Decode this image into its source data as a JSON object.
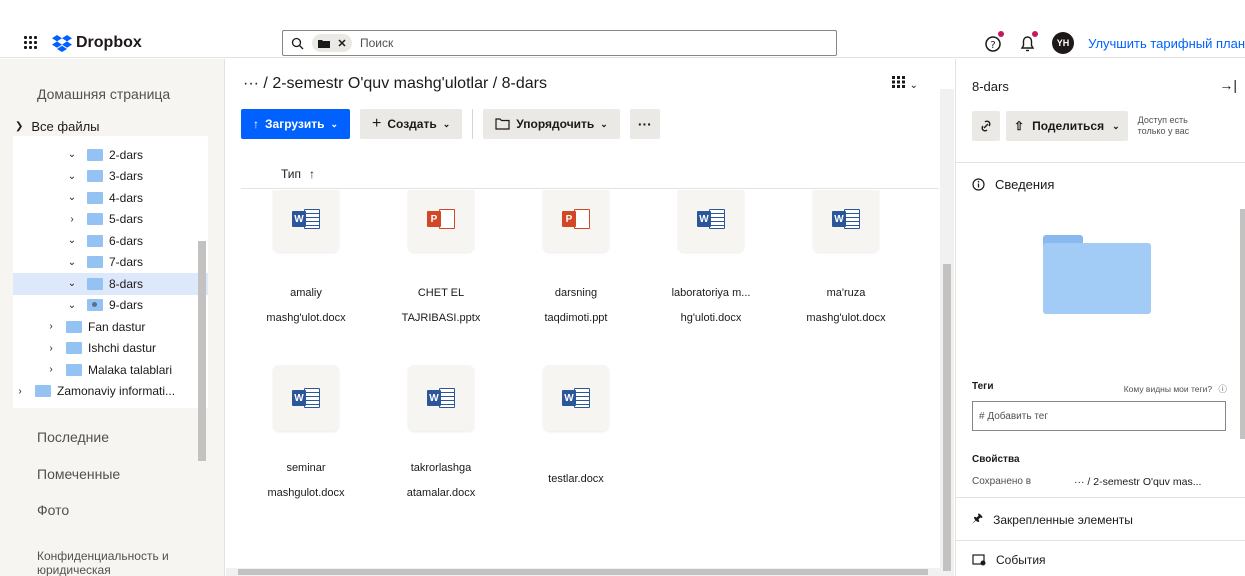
{
  "topbar": {
    "logo_text": "Dropbox",
    "search_chip_label": "",
    "search_placeholder": "Поиск",
    "avatar_initials": "YH",
    "upgrade_link": "Улучшить тарифный план",
    "brand_color": "#0061fe"
  },
  "sidebar": {
    "home": "Домашняя страница",
    "all_files": "Все файлы",
    "tree": [
      {
        "label": "2-dars",
        "chevron": "down",
        "selected": false
      },
      {
        "label": "3-dars",
        "chevron": "down",
        "selected": false
      },
      {
        "label": "4-dars",
        "chevron": "down",
        "selected": false
      },
      {
        "label": "5-dars",
        "chevron": "right",
        "selected": false
      },
      {
        "label": "6-dars",
        "chevron": "down",
        "selected": false
      },
      {
        "label": "7-dars",
        "chevron": "down",
        "selected": false
      },
      {
        "label": "8-dars",
        "chevron": "down",
        "selected": true
      },
      {
        "label": "9-dars",
        "chevron": "down",
        "selected": false
      },
      {
        "label": "Fan dastur",
        "chevron": "right",
        "selected": false
      },
      {
        "label": "Ishchi dastur",
        "chevron": "right",
        "selected": false
      },
      {
        "label": "Malaka talablari",
        "chevron": "right",
        "selected": false
      },
      {
        "label": "Zamonaviy informati...",
        "chevron": "right",
        "selected": false
      }
    ],
    "recent": "Последние",
    "starred": "Помеченные",
    "photos": "Фото",
    "privacy": "Конфиденциальность и юридическая"
  },
  "main": {
    "breadcrumb": "··· / 2-semestr O'quv mashg'ulotlar / 8-dars",
    "upload_label": "Загрузить",
    "create_label": "Создать",
    "organize_label": "Упорядочить",
    "more_label": "···",
    "sort_label": "Тип",
    "files": [
      {
        "line1": "amaliy",
        "line2": "mashg'ulot.docx",
        "type": "word"
      },
      {
        "line1": "CHET EL",
        "line2": "TAJRIBASI.pptx",
        "type": "ppt"
      },
      {
        "line1": "darsning",
        "line2": "taqdimoti.ppt",
        "type": "ppt"
      },
      {
        "line1": "laboratoriya m...",
        "line2": "hg'uloti.docx",
        "type": "word"
      },
      {
        "line1": "ma'ruza",
        "line2": "mashg'ulot.docx",
        "type": "word"
      },
      {
        "line1": "seminar",
        "line2": "mashgulot.docx",
        "type": "word"
      },
      {
        "line1": "takrorlashga",
        "line2": "atamalar.docx",
        "type": "word"
      },
      {
        "line1": "testlar.docx",
        "line2": "",
        "type": "word"
      }
    ],
    "word_badge": "W",
    "ppt_badge": "P"
  },
  "panel": {
    "title": "8-dars",
    "share_label": "Поделиться",
    "access_note": "Доступ есть только у вас",
    "info_label": "Сведения",
    "tags_label": "Теги",
    "tags_help": "Кому видны мои теги?",
    "tag_placeholder": "# Добавить тег",
    "props_label": "Свойства",
    "saved_in_label": "Сохранено в",
    "saved_in_value": "··· / 2-semestr O'quv mas...",
    "pinned_label": "Закрепленные элементы",
    "events_label": "События"
  }
}
